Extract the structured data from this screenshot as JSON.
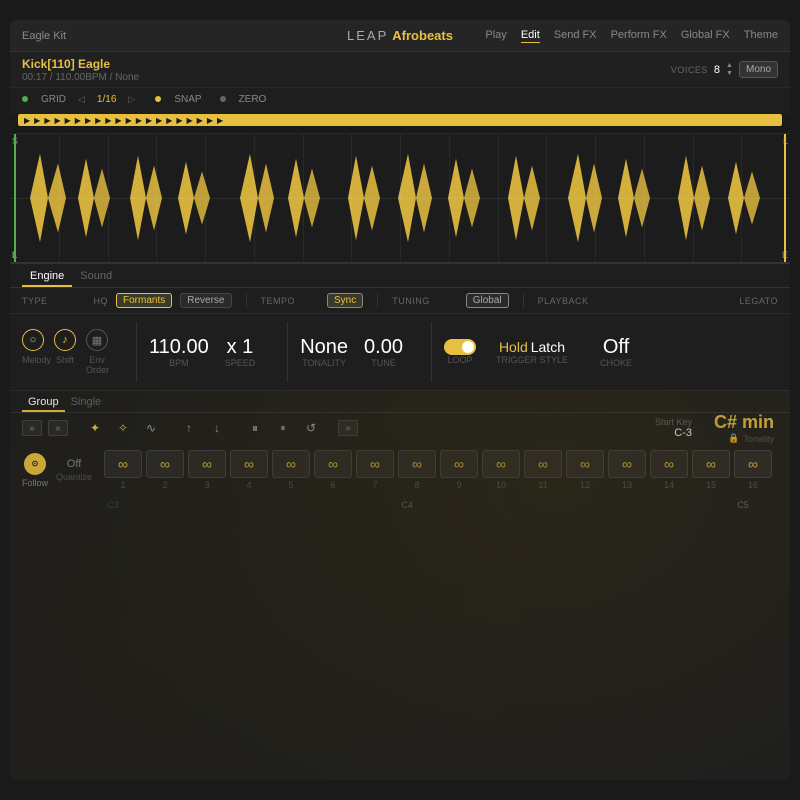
{
  "app": {
    "title_leap": "LEAP",
    "title_product": "Afrobeats"
  },
  "header": {
    "kit_name": "Eagle Kit",
    "nav": [
      "Play",
      "Edit",
      "Send FX",
      "Perform FX",
      "Global FX",
      "Theme"
    ],
    "active_nav": "Edit"
  },
  "track": {
    "name": "Kick[110] Eagle",
    "meta": "00:17 / 110.00BPM / None",
    "voices_label": "Voices",
    "voices_val": "8",
    "mono_label": "Mono"
  },
  "grid": {
    "grid_label": "GRID",
    "grid_val": "1/16",
    "snap_label": "SNAP",
    "zero_label": "ZERO"
  },
  "engine": {
    "tabs": [
      "Engine",
      "Sound"
    ],
    "active_tab": "Engine",
    "type_label": "TYPE",
    "hq_label": "HQ",
    "formants_label": "Formants",
    "reverse_label": "Reverse",
    "tempo_label": "TEMPO",
    "sync_label": "Sync",
    "tuning_label": "TUNING",
    "global_label": "Global",
    "playback_label": "PLAYBACK",
    "legato_label": "Legato",
    "bpm_val": "110.00",
    "bpm_unit": "BPM",
    "speed_val": "x 1",
    "speed_unit": "Speed",
    "tonality_val": "None",
    "tonality_unit": "Tonality",
    "tune_val": "0.00",
    "tune_unit": "Tune",
    "loop_label": "Loop",
    "trigger_style_label": "Trigger Style",
    "hold_label": "Hold",
    "latch_label": "Latch",
    "choke_label": "Choke",
    "choke_val": "Off",
    "melody_label": "Melody",
    "shift_label": "Shift",
    "env_order_label": "Env Order"
  },
  "group": {
    "tabs": [
      "Group",
      "Single"
    ],
    "active_tab": "Group",
    "start_key_label": "Start Key",
    "start_key_val": "C-3",
    "tonality_val": "C# min",
    "tonality_label": "Tonality",
    "follow_label": "Follow",
    "quantize_val": "Off",
    "quantize_label": "Quantize"
  },
  "pads": {
    "items": [
      {
        "num": "1",
        "note": "C3"
      },
      {
        "num": "2",
        "note": ""
      },
      {
        "num": "3",
        "note": ""
      },
      {
        "num": "4",
        "note": ""
      },
      {
        "num": "5",
        "note": ""
      },
      {
        "num": "6",
        "note": ""
      },
      {
        "num": "7",
        "note": ""
      },
      {
        "num": "8",
        "note": "C4"
      },
      {
        "num": "9",
        "note": ""
      },
      {
        "num": "10",
        "note": ""
      },
      {
        "num": "11",
        "note": ""
      },
      {
        "num": "12",
        "note": ""
      },
      {
        "num": "13",
        "note": ""
      },
      {
        "num": "14",
        "note": ""
      },
      {
        "num": "15",
        "note": ""
      },
      {
        "num": "16",
        "note": "C5"
      }
    ]
  }
}
